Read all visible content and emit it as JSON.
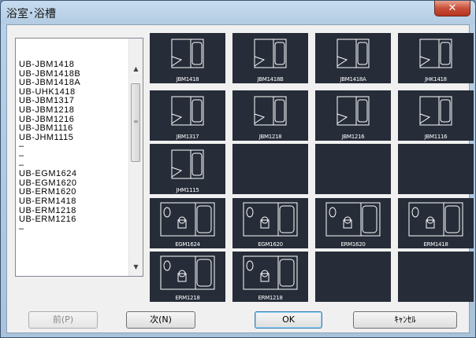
{
  "window": {
    "title": "浴室･浴槽",
    "close_glyph": "✕"
  },
  "list": {
    "items": [
      "UB-JBM1418",
      "UB-JBM1418B",
      "UB-JBM1418A",
      "UB-UHK1418",
      "UB-JBM1317",
      "UB-JBM1218",
      "UB-JBM1216",
      "UB-JBM1116",
      "UB-JHM1115",
      "–",
      "–",
      "–",
      "UB-EGM1624",
      "UB-EGM1620",
      "UB-ERM1620",
      "UB-ERM1418",
      "UB-ERM1218",
      "UB-ERM1216",
      "–"
    ],
    "scroll_up": "▲",
    "scroll_down": "▼",
    "grip": "≡"
  },
  "tiles": [
    {
      "label": "JBM1418",
      "kind": "tub"
    },
    {
      "label": "JBM1418B",
      "kind": "tub"
    },
    {
      "label": "JBM1418A",
      "kind": "tub"
    },
    {
      "label": "JHK1418",
      "kind": "tub"
    },
    {
      "label": "JBM1317",
      "kind": "tub"
    },
    {
      "label": "JBM1218",
      "kind": "tub"
    },
    {
      "label": "JBM1216",
      "kind": "tub"
    },
    {
      "label": "JBM1116",
      "kind": "tub"
    },
    {
      "label": "JHM1115",
      "kind": "tub"
    },
    {
      "label": "",
      "kind": "empty"
    },
    {
      "label": "",
      "kind": "empty"
    },
    {
      "label": "",
      "kind": "empty"
    },
    {
      "label": "EGM1624",
      "kind": "toilet"
    },
    {
      "label": "EGM1620",
      "kind": "toilet"
    },
    {
      "label": "ERM1620",
      "kind": "toilet"
    },
    {
      "label": "ERM1418",
      "kind": "toilet"
    },
    {
      "label": "ERM1218",
      "kind": "toilet"
    },
    {
      "label": "ERM1218",
      "kind": "toilet"
    },
    {
      "label": "",
      "kind": "empty"
    },
    {
      "label": "",
      "kind": "empty"
    }
  ],
  "buttons": {
    "prev": "前(P)",
    "next": "次(N)",
    "ok": "OK",
    "cancel": "ｷｬﾝｾﾙ"
  },
  "colors": {
    "tile_bg": "#262c38",
    "line": "#ffffff",
    "accent_default": "#3c7fb1"
  }
}
